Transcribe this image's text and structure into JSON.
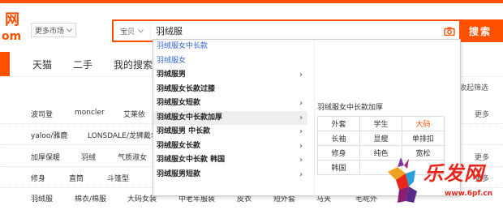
{
  "logo": {
    "line1": "网",
    "line2": "om"
  },
  "market": {
    "label": "更多市场"
  },
  "search": {
    "scope": "宝贝",
    "value": "羽绒服",
    "button": "搜索"
  },
  "nav": {
    "tabs": [
      "天猫",
      "二手",
      "我的搜索"
    ],
    "right": "收起筛选"
  },
  "filter_rows": [
    {
      "cells": [
        "波司登",
        "moncler",
        "艾莱依"
      ],
      "more": "更多"
    },
    {
      "cells": [
        "yaloo/雅鹿",
        "LONSDALE/龙狮戴尔"
      ],
      "more": ""
    },
    {
      "cells": [
        "加厚保暖",
        "羽绒",
        "气质淑女"
      ],
      "more": "更多"
    },
    {
      "cells": [
        "修身",
        "直筒",
        "斗篷型"
      ],
      "more": "更多"
    },
    {
      "cells": [
        "羽绒服",
        "棉衣/棉服",
        "大码女装",
        "中老年服装",
        "皮衣",
        "短外套",
        "马夹",
        "毛呢外"
      ],
      "more": ""
    }
  ],
  "suggestions": [
    {
      "text": "羽绒服女中长款",
      "style": "blue",
      "arrow": false
    },
    {
      "text": "羽绒服女",
      "style": "blue",
      "arrow": false
    },
    {
      "text": "羽绒服男",
      "style": "bold",
      "arrow": true
    },
    {
      "text": "羽绒服女长款过膝",
      "style": "bold",
      "arrow": false
    },
    {
      "text": "羽绒服女短款",
      "style": "bold",
      "arrow": true
    },
    {
      "text": "羽绒服女中长款加厚",
      "style": "active",
      "arrow": true
    },
    {
      "text": "羽绒服男 中长款",
      "style": "bold",
      "arrow": true
    },
    {
      "text": "羽绒服女长款",
      "style": "bold",
      "arrow": true
    },
    {
      "text": "羽绒服女中长款 韩国",
      "style": "bold",
      "arrow": true
    },
    {
      "text": "羽绒服男短款",
      "style": "bold",
      "arrow": true
    }
  ],
  "panel": {
    "title": "羽绒服女中长款加厚",
    "tags": [
      "外套",
      "学生",
      "大码",
      "长袖",
      "显瘦",
      "单排扣",
      "修身",
      "纯色",
      "宽松",
      "韩国",
      "",
      ""
    ],
    "hot_tag": "大码"
  },
  "watermark": {
    "brand": "乐发网",
    "url": "www.6pf.cn"
  },
  "colors": {
    "accent": "#ff5000",
    "link": "#3366cc",
    "watermark": "#e8261c"
  }
}
